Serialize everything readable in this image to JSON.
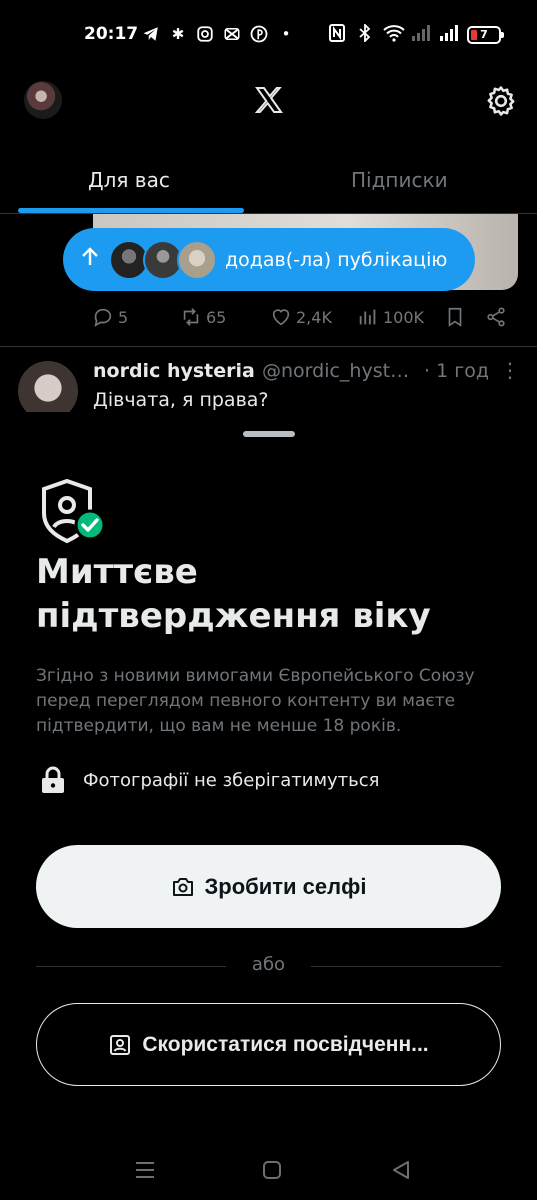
{
  "status_bar": {
    "time": "20:17",
    "left_icons": [
      "telegram-icon",
      "asterisk-icon",
      "instagram-icon",
      "capcut-icon",
      "pinterest-icon",
      "dot-icon"
    ],
    "right_icons": [
      "nfc-icon",
      "bluetooth-icon",
      "wifi-icon",
      "signal-icon",
      "signal-icon"
    ],
    "battery": "7"
  },
  "header": {
    "logo": "x-logo-icon",
    "settings_icon": "gear-icon"
  },
  "tabs": [
    {
      "label": "Для вас",
      "active": true
    },
    {
      "label": "Підписки",
      "active": false
    }
  ],
  "new_posts_pill": {
    "label": "додав(-ла) публікацію"
  },
  "post_actions": {
    "replies": "5",
    "reposts": "65",
    "likes": "2,4K",
    "views": "100K"
  },
  "post": {
    "name": "nordic hysteria",
    "handle": "@nordic_hysteria",
    "time": "· 1 год",
    "text": "Дівчата, я права?"
  },
  "sheet": {
    "title": "Миттєве підтвердження віку",
    "description": "Згідно з новими вимогами Європейського Союзу перед переглядом певного контенту ви маєте підтвердити, що вам не менше 18 років.",
    "note": "Фотографії не зберігатимуться",
    "selfie_button": "Зробити селфі",
    "or_text": "або",
    "id_button": "Скористатися посвідченн..."
  },
  "colors": {
    "accent": "#1d9bf0",
    "success": "#00ba7c",
    "background": "#000000",
    "muted": "#71767b"
  }
}
